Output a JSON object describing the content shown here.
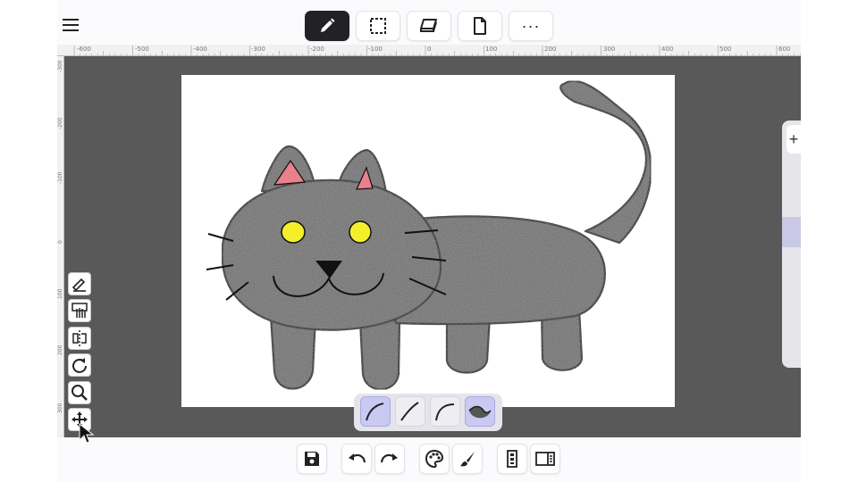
{
  "header": {
    "menu_icon": "hamburger-menu-icon",
    "tools": [
      {
        "name": "pen-tool",
        "icon": "pencil-icon",
        "active": true
      },
      {
        "name": "selection-tool",
        "icon": "dashed-rectangle-select-icon",
        "active": false
      },
      {
        "name": "eraser-tool",
        "icon": "eraser-icon",
        "active": false
      },
      {
        "name": "page-tool",
        "icon": "document-icon",
        "active": false
      },
      {
        "name": "more-tools",
        "label": "···",
        "active": false
      }
    ]
  },
  "rulers": {
    "horizontal_labels": [
      "-600",
      "-500",
      "-400",
      "-300",
      "-200",
      "-100",
      "0",
      "100",
      "200",
      "300",
      "400",
      "500",
      "600"
    ],
    "vertical_labels": [
      "-300",
      "-200",
      "-100",
      "0",
      "100",
      "200",
      "300"
    ]
  },
  "canvas": {
    "background": "#ffffff",
    "workspace_color": "#595959",
    "drawing": "gray-cat-drawing",
    "cat_fill": "#6e6e6e",
    "eye_color": "#f4ef2a",
    "ear_inner_color": "#e9808c"
  },
  "side_panel": {
    "add_button_label": "+"
  },
  "left_tools": [
    {
      "name": "pen-settings-tool",
      "icon": "pen-lines-icon"
    },
    {
      "name": "hand-pan-tool",
      "icon": "hand-icon"
    },
    {
      "name": "mirror-tool",
      "icon": "flip-icon"
    },
    {
      "name": "rotate-tool",
      "icon": "rotate-icon"
    },
    {
      "name": "zoom-tool",
      "icon": "magnifier-icon"
    },
    {
      "name": "move-tool",
      "icon": "move-arrows-icon"
    }
  ],
  "curve_styles": [
    {
      "name": "curve-style-1",
      "selected": true
    },
    {
      "name": "curve-style-2",
      "selected": false
    },
    {
      "name": "curve-style-3",
      "selected": false
    },
    {
      "name": "curve-style-4",
      "selected": true
    }
  ],
  "bottom_toolbar": [
    {
      "name": "save-button",
      "icon": "floppy-disk-icon"
    },
    {
      "name": "undo-button",
      "icon": "undo-arrow-icon"
    },
    {
      "name": "redo-button",
      "icon": "redo-arrow-icon"
    },
    {
      "name": "color-palette-button",
      "icon": "palette-icon"
    },
    {
      "name": "brush-button",
      "icon": "brush-icon"
    },
    {
      "name": "layers-button",
      "icon": "layers-panel-icon"
    },
    {
      "name": "side-panel-toggle-button",
      "icon": "sidebar-toggle-icon"
    }
  ]
}
